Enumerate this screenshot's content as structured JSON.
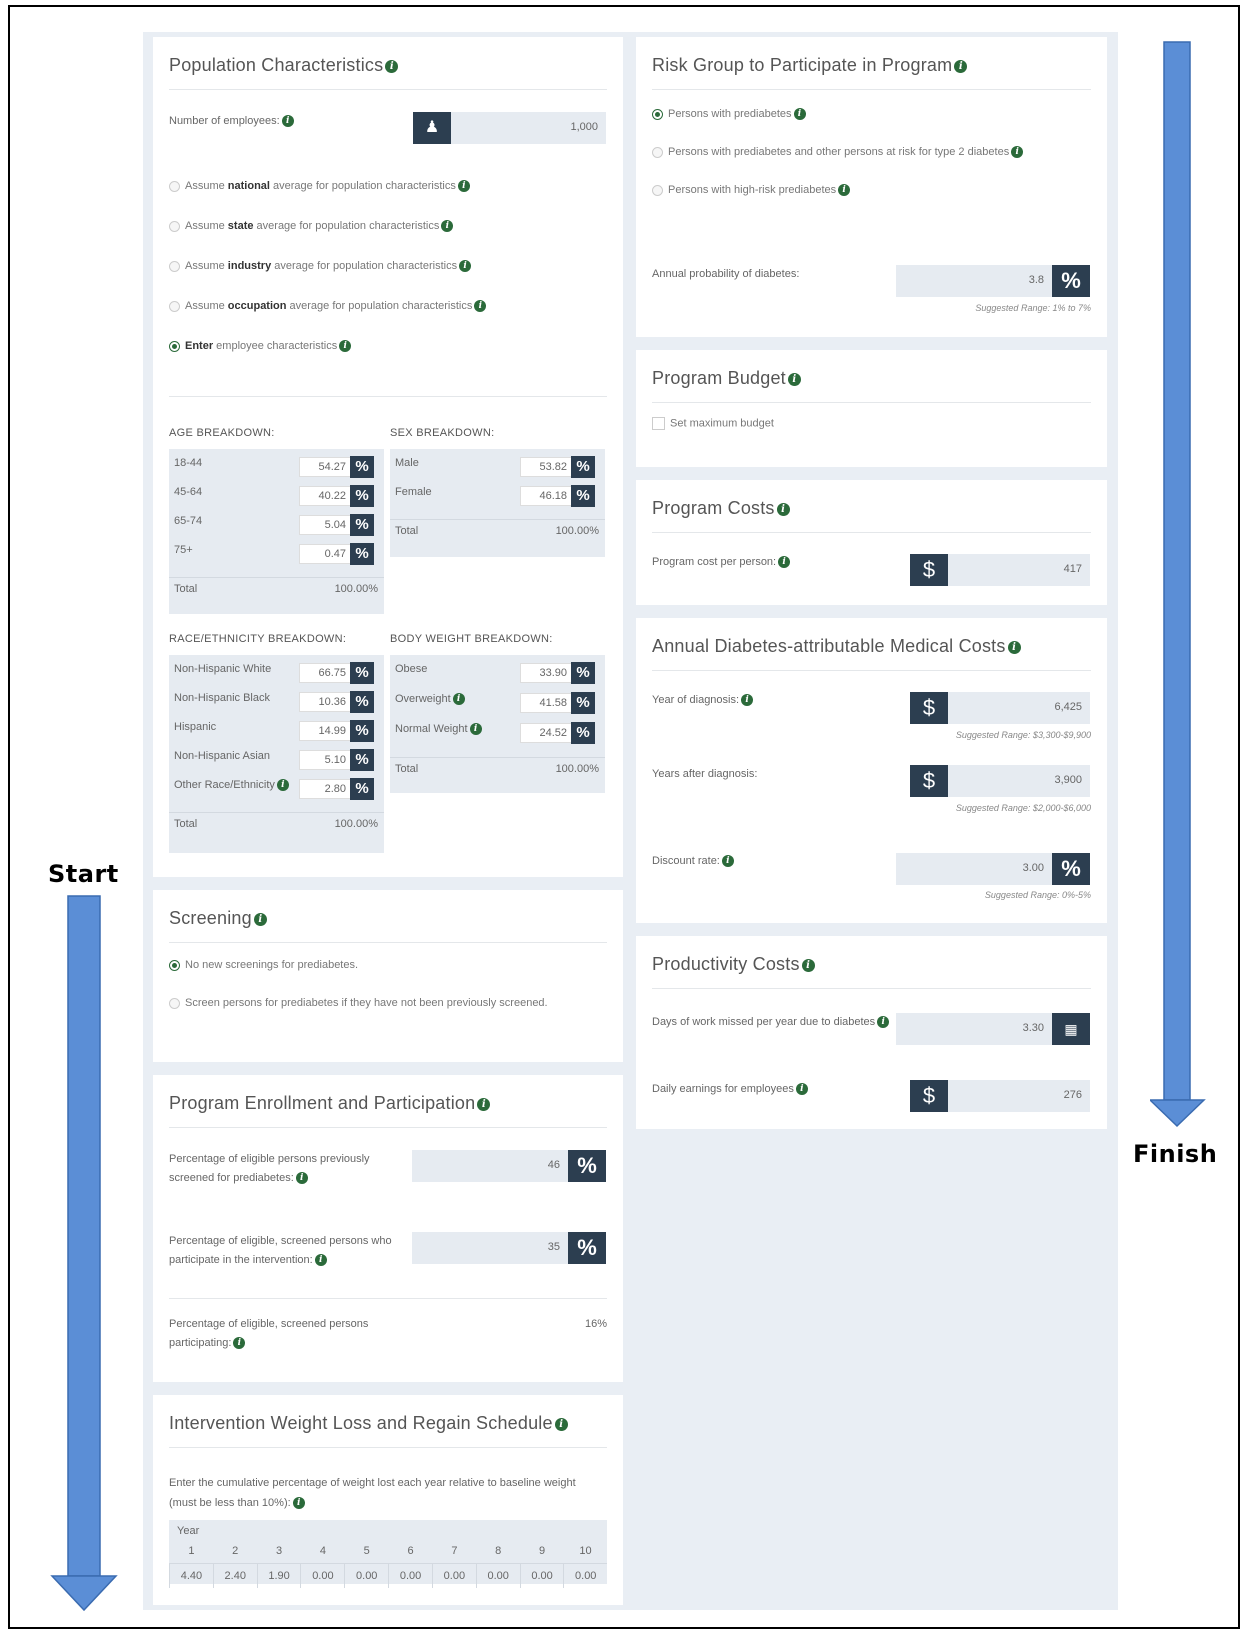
{
  "labels": {
    "start": "Start",
    "finish": "Finish"
  },
  "colors": {
    "arrow": "#5b8ed6",
    "accent": "#2c3e50",
    "radio_on": "#2b6a3a",
    "background": "#e9eef4"
  },
  "population": {
    "title": "Population Characteristics",
    "employees_label": "Number of employees:",
    "employees_value": "1,000",
    "employees_icon": "person-icon",
    "radios": [
      {
        "pre": "Assume ",
        "bold": "national",
        "post": " average for population characteristics",
        "selected": false
      },
      {
        "pre": "Assume ",
        "bold": "state",
        "post": " average for population characteristics",
        "selected": false
      },
      {
        "pre": "Assume ",
        "bold": "industry",
        "post": " average for population characteristics",
        "selected": false
      },
      {
        "pre": "Assume ",
        "bold": "occupation",
        "post": " average for population characteristics",
        "selected": false
      },
      {
        "pre": "",
        "bold": "Enter",
        "post": " employee characteristics",
        "selected": true
      }
    ],
    "age": {
      "title": "AGE BREAKDOWN:",
      "rows": [
        {
          "label": "18-44",
          "value": "54.27"
        },
        {
          "label": "45-64",
          "value": "40.22"
        },
        {
          "label": "65-74",
          "value": "5.04"
        },
        {
          "label": "75+",
          "value": "0.47"
        }
      ],
      "total_label": "Total",
      "total_value": "100.00%"
    },
    "sex": {
      "title": "SEX BREAKDOWN:",
      "rows": [
        {
          "label": "Male",
          "value": "53.82"
        },
        {
          "label": "Female",
          "value": "46.18"
        }
      ],
      "total_label": "Total",
      "total_value": "100.00%"
    },
    "race": {
      "title": "RACE/ETHNICITY BREAKDOWN:",
      "rows": [
        {
          "label": "Non-Hispanic White",
          "value": "66.75"
        },
        {
          "label": "Non-Hispanic Black",
          "value": "10.36"
        },
        {
          "label": "Hispanic",
          "value": "14.99"
        },
        {
          "label": "Non-Hispanic Asian",
          "value": "5.10"
        },
        {
          "label": "Other Race/Ethnicity",
          "value": "2.80"
        }
      ],
      "total_label": "Total",
      "total_value": "100.00%"
    },
    "weight": {
      "title": "BODY WEIGHT BREAKDOWN:",
      "rows": [
        {
          "label": "Obese",
          "value": "33.90"
        },
        {
          "label": "Overweight",
          "value": "41.58"
        },
        {
          "label": "Normal Weight",
          "value": "24.52"
        }
      ],
      "total_label": "Total",
      "total_value": "100.00%"
    },
    "percent_symbol": "%"
  },
  "screening": {
    "title": "Screening",
    "options": [
      {
        "label": "No new screenings for prediabetes.",
        "selected": true
      },
      {
        "label": "Screen persons for prediabetes if they have not been previously screened.",
        "selected": false
      }
    ]
  },
  "enrollment": {
    "title": "Program Enrollment and Participation",
    "screened_label_1": "Percentage of eligible persons previously",
    "screened_label_2": "screened for prediabetes:",
    "screened_value": "46",
    "participate_label_1": "Percentage of eligible, screened persons who",
    "participate_label_2": "participate in the intervention:",
    "participate_value": "35",
    "participating_label_1": "Percentage of eligible, screened persons",
    "participating_label_2": "participating:",
    "participating_value": "16%"
  },
  "weightloss": {
    "title": "Intervention Weight Loss and Regain Schedule",
    "desc_1": "Enter the cumulative percentage of weight lost each year relative to baseline weight",
    "desc_2": "(must be less than 10%):",
    "year_label": "Year",
    "years": [
      "1",
      "2",
      "3",
      "4",
      "5",
      "6",
      "7",
      "8",
      "9",
      "10"
    ],
    "values": [
      "4.40",
      "2.40",
      "1.90",
      "0.00",
      "0.00",
      "0.00",
      "0.00",
      "0.00",
      "0.00",
      "0.00"
    ]
  },
  "risk": {
    "title": "Risk Group to Participate in Program",
    "options": [
      {
        "label": "Persons with prediabetes",
        "selected": true
      },
      {
        "label": "Persons with prediabetes and other persons at risk for type 2 diabetes",
        "selected": false
      },
      {
        "label": "Persons with high-risk prediabetes",
        "selected": false
      }
    ],
    "prob_label": "Annual probability of diabetes:",
    "prob_value": "3.8",
    "prob_range": "Suggested Range: 1% to 7%"
  },
  "budget": {
    "title": "Program Budget",
    "checkbox_label": "Set maximum budget",
    "checked": false
  },
  "costs": {
    "title": "Program Costs",
    "label": "Program cost per person:",
    "value": "417",
    "currency": "$"
  },
  "medical": {
    "title": "Annual Diabetes-attributable Medical Costs",
    "year_label": "Year of diagnosis:",
    "year_value": "6,425",
    "year_range": "Suggested Range: $3,300-$9,900",
    "after_label": "Years after diagnosis:",
    "after_value": "3,900",
    "after_range": "Suggested Range: $2,000-$6,000",
    "discount_label": "Discount rate:",
    "discount_value": "3.00",
    "discount_range": "Suggested Range: 0%-5%"
  },
  "productivity": {
    "title": "Productivity Costs",
    "days_label": "Days of work missed per year due to diabetes",
    "days_value": "3.30",
    "days_icon": "calendar-icon",
    "earn_label": "Daily earnings for employees",
    "earn_value": "276"
  }
}
